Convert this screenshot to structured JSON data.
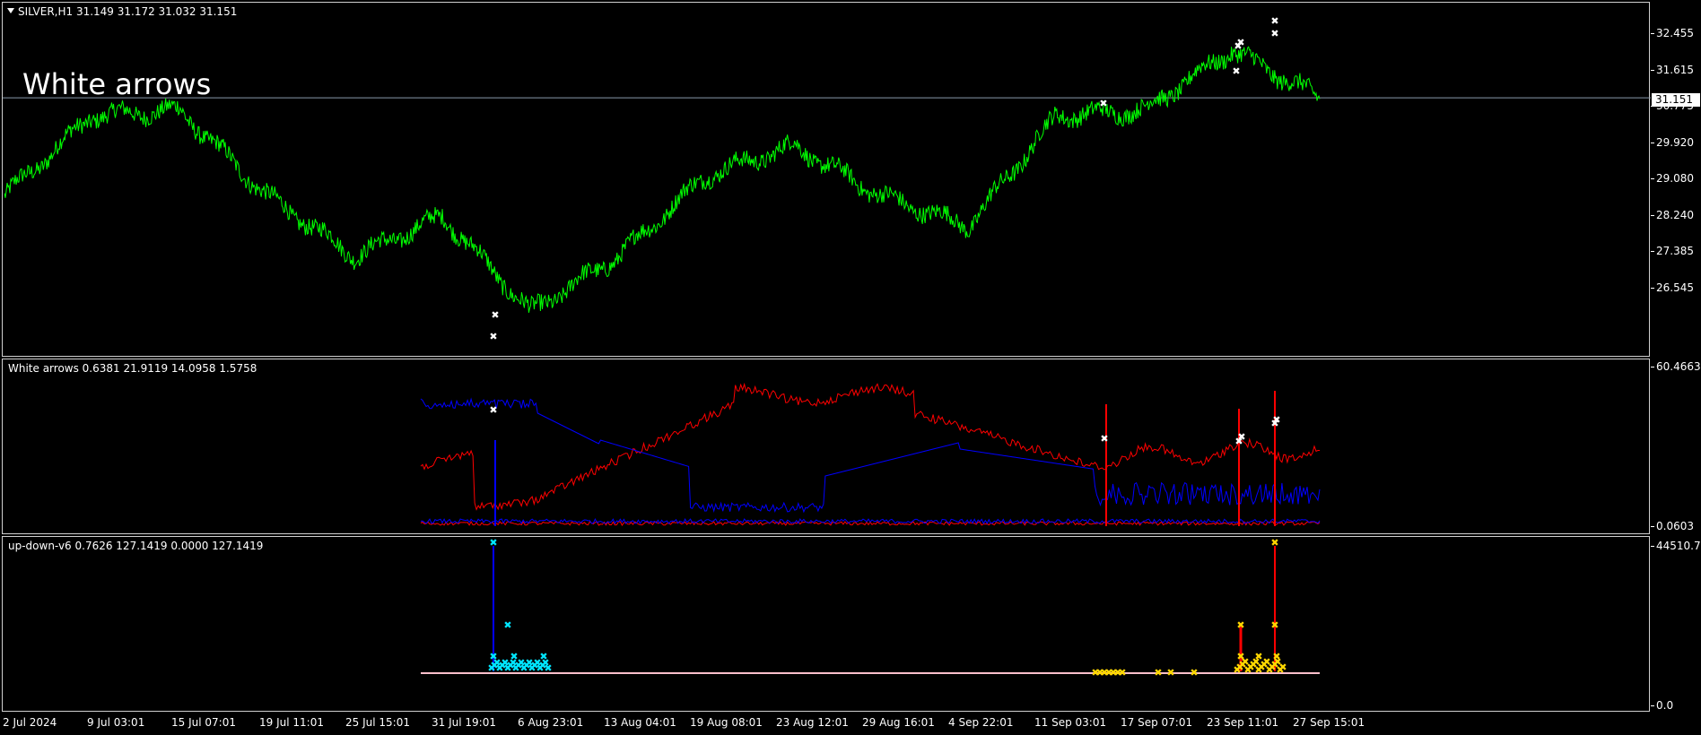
{
  "main": {
    "title": "SILVER,H1  31.149 31.172 31.032 31.151",
    "overlay_label": "White arrows",
    "current_price": "31.151",
    "price_ticks": [
      "32.455",
      "31.615",
      "30.775",
      "29.920",
      "29.080",
      "28.240",
      "27.385",
      "26.545"
    ],
    "price_color": "#00ff00"
  },
  "ind1": {
    "title": "White arrows 0.6381 21.9119 14.0958 1.5758",
    "axis_top": "60.4663",
    "axis_bottom": "0.0603",
    "series_colors": [
      "#ff0000",
      "#0000ff",
      "#ffffff"
    ]
  },
  "ind2": {
    "title": "up-down-v6 0.7626 127.1419 0.0000 127.1419",
    "axis_top": "44510.71",
    "axis_bottom": "0.0",
    "series_colors": [
      "#00e5ff",
      "#ffd700",
      "#ff0000",
      "#0000ff"
    ]
  },
  "time_axis": [
    "2 Jul 2024",
    "9 Jul 03:01",
    "15 Jul 07:01",
    "19 Jul 11:01",
    "25 Jul 15:01",
    "31 Jul 19:01",
    "6 Aug 23:01",
    "13 Aug 04:01",
    "19 Aug 08:01",
    "23 Aug 12:01",
    "29 Aug 16:01",
    "4 Sep 22:01",
    "11 Sep 03:01",
    "17 Sep 07:01",
    "23 Sep 11:01",
    "27 Sep 15:01"
  ],
  "chart_data": {
    "type": "line",
    "title": "SILVER,H1",
    "ylim": [
      26.2,
      32.9
    ],
    "x": [
      "2 Jul 2024",
      "9 Jul 03:01",
      "15 Jul 07:01",
      "19 Jul 11:01",
      "25 Jul 15:01",
      "31 Jul 19:01",
      "6 Aug 23:01",
      "13 Aug 04:01",
      "19 Aug 08:01",
      "23 Aug 12:01",
      "29 Aug 16:01",
      "4 Sep 22:01",
      "11 Sep 03:01",
      "17 Sep 07:01",
      "23 Sep 11:01",
      "27 Sep 15:01"
    ],
    "series": [
      {
        "values": [
          29.2,
          30.8,
          30.9,
          29.2,
          28.0,
          28.8,
          26.9,
          28.0,
          29.6,
          30.2,
          29.2,
          28.6,
          30.8,
          30.9,
          32.1,
          31.15
        ]
      }
    ]
  }
}
